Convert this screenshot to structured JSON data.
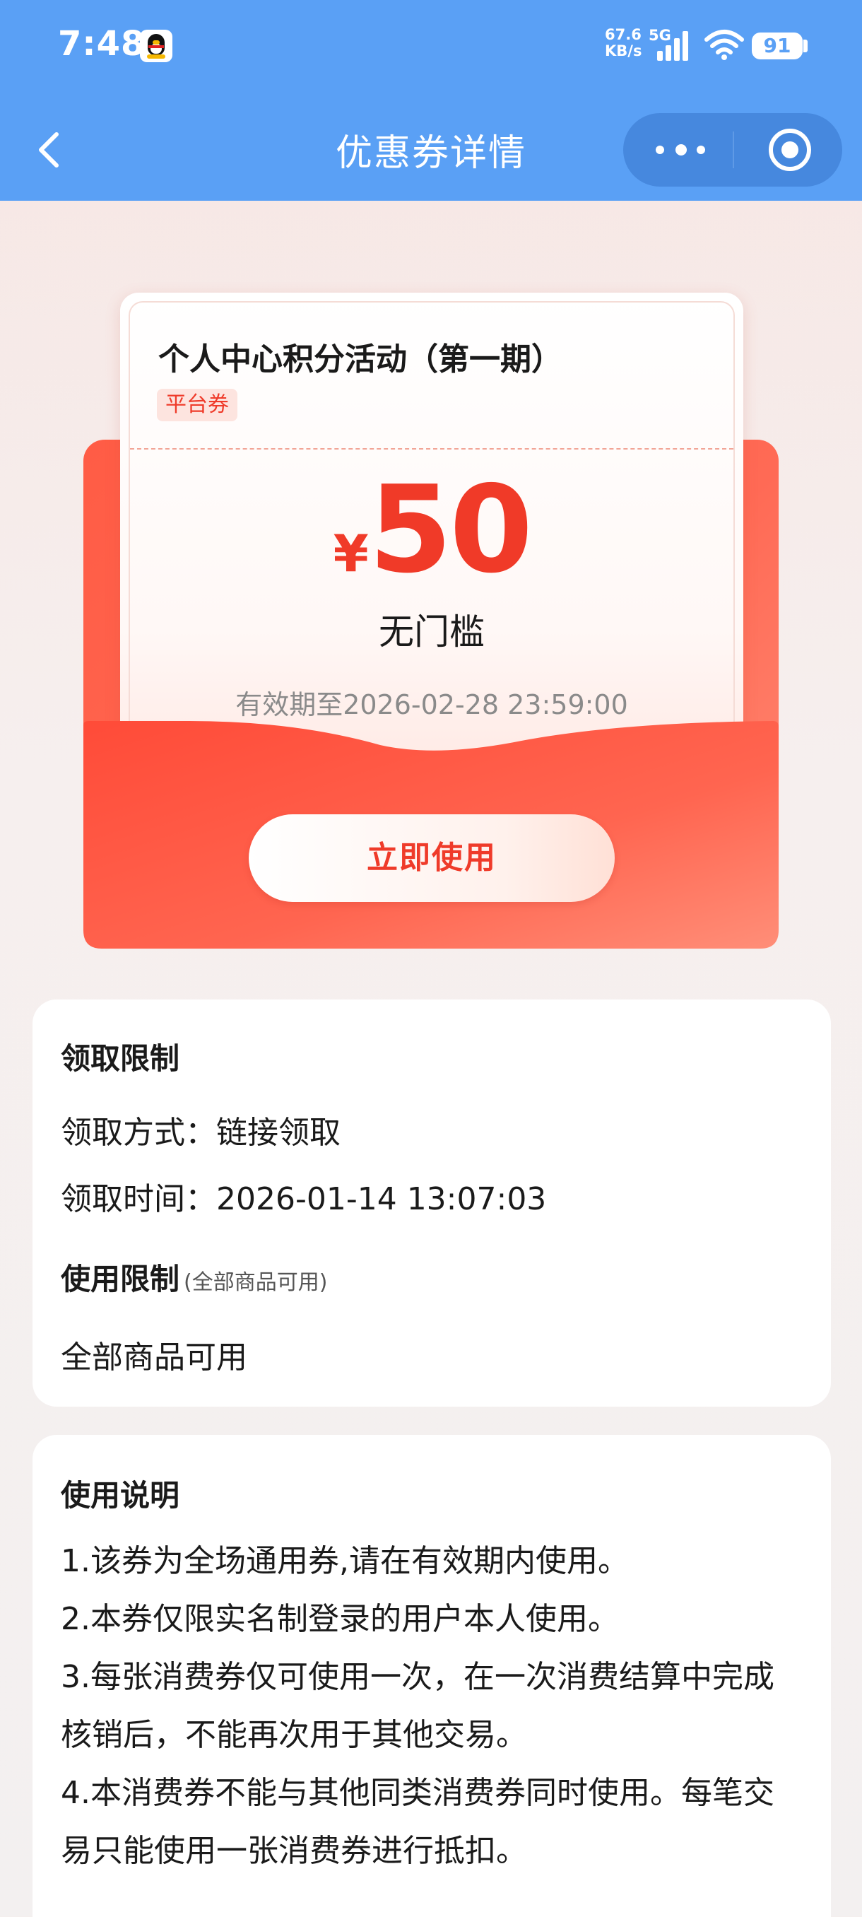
{
  "status_bar": {
    "time": "7:48",
    "net_speed_value": "67.6",
    "net_speed_unit": "KB/s",
    "network_type": "5G",
    "battery": "91",
    "icons": [
      "qq-icon",
      "signal-icon",
      "wifi-icon",
      "battery-icon"
    ]
  },
  "nav": {
    "title": "优惠券详情",
    "icons": [
      "back-icon",
      "more-icon",
      "target-icon"
    ]
  },
  "coupon": {
    "title": "个人中心积分活动（第一期）",
    "tag": "平台券",
    "currency_symbol": "¥",
    "amount": "50",
    "threshold": "无门槛",
    "validity": "有效期至2026-02-28 23:59:00",
    "use_button": "立即使用"
  },
  "limits": {
    "claim_title": "领取限制",
    "claim_method": "领取方式：链接领取",
    "claim_time": "领取时间：2026-01-14 13:07:03",
    "usage_title": "使用限制",
    "usage_note": "(全部商品可用)",
    "usage_value": "全部商品可用"
  },
  "notes": {
    "title": "使用说明",
    "items": [
      "1.该券为全场通用券,请在有效期内使用。",
      "2.本券仅限实名制登录的用户本人使用。",
      "3.每张消费券仅可使用一次，在一次消费结算中完成核销后，不能再次用于其他交易。",
      "4.本消费券不能与其他同类消费券同时使用。每笔交易只能使用一张消费券进行抵扣。"
    ]
  },
  "colors": {
    "header": "#5aa0f5",
    "accent_red": "#f03a28",
    "coupon_red": "#ff5c45"
  }
}
